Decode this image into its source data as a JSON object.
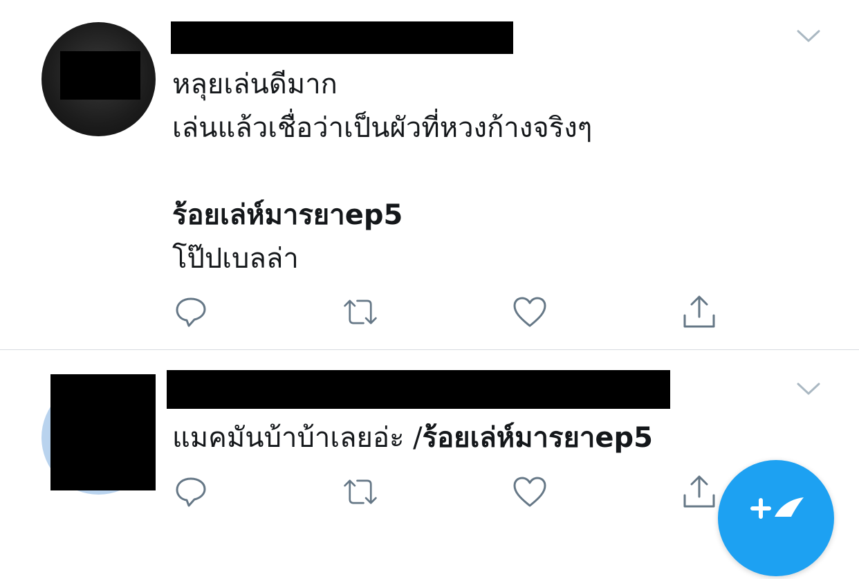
{
  "tweets": [
    {
      "lines": [
        {
          "text": "หลุยเล่นดีมาก",
          "bold": false
        },
        {
          "text": "เล่นแล้วเชื่อว่าเป็นผัวที่หวงก้างจริงๆ",
          "bold": false
        },
        {
          "text": "",
          "bold": false
        },
        {
          "text": "ร้อยเล่ห์มารยาep5",
          "bold": true
        },
        {
          "text": "โป๊ปเบลล่า",
          "bold": false
        }
      ],
      "actions": {
        "reply_icon": "reply-icon",
        "retweet_icon": "retweet-icon",
        "like_icon": "heart-icon",
        "share_icon": "share-icon"
      }
    },
    {
      "text_plain": "แมคมันบ้าบ้าเลยอ่ะ /",
      "hashtag": "ร้อยเล่ห์มารยาep5",
      "actions": {
        "reply_icon": "reply-icon",
        "retweet_icon": "retweet-icon",
        "like_icon": "heart-icon",
        "share_icon": "share-icon"
      }
    }
  ],
  "compose_fab": {
    "icon": "compose-tweet-icon"
  },
  "colors": {
    "text": "#14171a",
    "icon": "#657786",
    "divider": "#d7dbdf",
    "caret": "#aab8c2",
    "accent": "#1da1f2",
    "redaction": "#000000"
  }
}
